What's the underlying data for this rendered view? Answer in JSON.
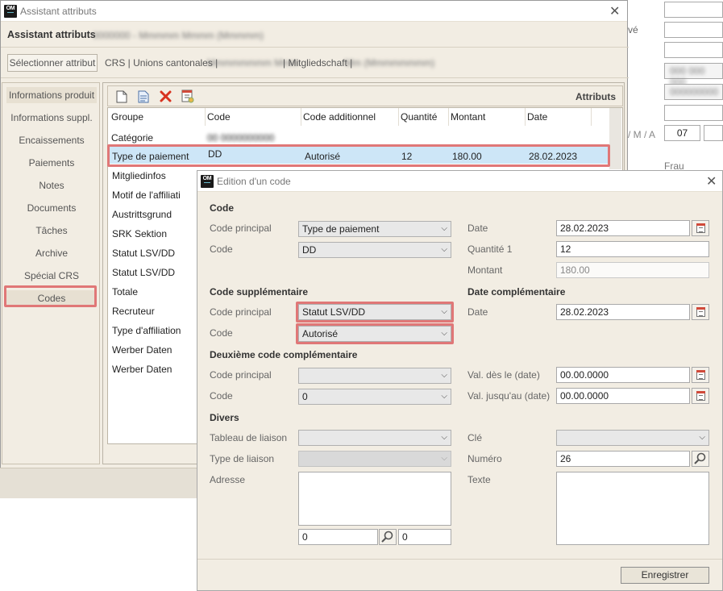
{
  "background_window": {
    "label_ve": "vé",
    "date_label": "/ M / A",
    "date_value": "07",
    "label_frau": "Frau"
  },
  "main_window": {
    "title": "Assistant attributs",
    "heading": "Assistant attributs",
    "select_button": "Sélectionner attribut",
    "context_line": "CRS | Unions cantonales |",
    "context_line2": "| Mitgliedschaft |",
    "nav_items": [
      "Informations produit",
      "Informations suppl.",
      "Encaissements",
      "Paiements",
      "Notes",
      "Documents",
      "Tâches",
      "Archive",
      "Spécial CRS",
      "Codes"
    ],
    "grid": {
      "toolbar_title": "Attributs",
      "columns": [
        "Groupe",
        "Code",
        "Code additionnel",
        "Quantité",
        "Montant",
        "Date"
      ],
      "rows": [
        {
          "groupe": "Catégorie"
        },
        {
          "groupe": "Type de paiement",
          "code": "DD",
          "code_add": "Autorisé",
          "quantite": "12",
          "montant": "180.00",
          "date": "28.02.2023"
        },
        {
          "groupe": "Mitgliedinfos"
        },
        {
          "groupe": "Motif de l'affiliati"
        },
        {
          "groupe": "Austrittsgrund"
        },
        {
          "groupe": "SRK Sektion"
        },
        {
          "groupe": "Statut LSV/DD"
        },
        {
          "groupe": "Statut LSV/DD"
        },
        {
          "groupe": "Totale"
        },
        {
          "groupe": "Recruteur"
        },
        {
          "groupe": "Type d'affiliation"
        },
        {
          "groupe": "Werber Daten"
        },
        {
          "groupe": "Werber Daten"
        }
      ]
    }
  },
  "dialog": {
    "title": "Edition d'un code",
    "code_section": "Code",
    "code_principal_label": "Code principal",
    "code_principal_value": "Type de paiement",
    "code_label": "Code",
    "code_value": "DD",
    "date_label": "Date",
    "date_value": "28.02.2023",
    "quantite_label": "Quantité 1",
    "quantite_value": "12",
    "montant_label": "Montant",
    "montant_value": "180.00",
    "supp_section": "Code supplémentaire",
    "supp_code_principal_label": "Code principal",
    "supp_code_principal_value": "Statut LSV/DD",
    "supp_code_label": "Code",
    "supp_code_value": "Autorisé",
    "date_comp_section": "Date complémentaire",
    "date_comp_label": "Date",
    "date_comp_value": "28.02.2023",
    "deux_section": "Deuxième code complémentaire",
    "deux_code_principal_label": "Code principal",
    "deux_code_principal_value": "",
    "deux_code_label": "Code",
    "deux_code_value": "0",
    "val_des_label": "Val. dès le (date)",
    "val_des_value": "00.00.0000",
    "val_jusqu_label": "Val. jusqu'au (date)",
    "val_jusqu_value": "00.00.0000",
    "divers_section": "Divers",
    "tableau_label": "Tableau de liaison",
    "type_liaison_label": "Type de liaison",
    "adresse_label": "Adresse",
    "adresse_num1": "0",
    "adresse_num2": "0",
    "cle_label": "Clé",
    "numero_label": "Numéro",
    "numero_value": "26",
    "texte_label": "Texte",
    "save_button": "Enregistrer"
  }
}
